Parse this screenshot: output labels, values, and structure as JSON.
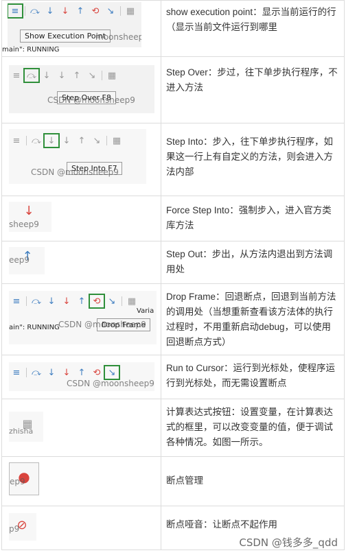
{
  "rows": [
    {
      "desc": "show execution point：显示当前运行的行（显示当前文件运行到哪里",
      "tooltip": "Show Execution Point",
      "watermark": "moonsheep9",
      "extra": "main\": RUNNING"
    },
    {
      "desc": "Step Over：步过，往下单步执行程序，不进入方法",
      "tooltip": "Step Over F8",
      "watermark": "CSDN @moonsheep9"
    },
    {
      "desc": "Step Into：步入，往下单步执行程序，如果这一行上有自定义的方法，则会进入方法内部",
      "tooltip": "Step Into F7",
      "watermark": "CSDN @moonsheep9"
    },
    {
      "desc": "Force Step Into：强制步入，进入官方类库方法",
      "watermark": "sheep9"
    },
    {
      "desc": "Step Out：步出，从方法内退出到方法调用处",
      "watermark": "eep9"
    },
    {
      "desc": "Drop Frame：回退断点，回退到当前方法的调用处（当想重新查看该方法体的执行过程时，不用重新启动debug，可以使用回退断点方式）",
      "tooltip": "Drop Frame",
      "watermark": "CSDN @moonsheep9",
      "extra": "ain\": RUNNING",
      "extra2": "Varia"
    },
    {
      "desc": "Run to Cursor：运行到光标处，使程序运行到光标处，而无需设置断点",
      "watermark": "CSDN @moonsheep9"
    },
    {
      "desc": "计算表达式按钮：设置变量，在计算表达式的框里，可以改变变量的值，便于调试各种情况。如图一所示。",
      "watermark": "zhisha"
    },
    {
      "desc": "断点管理",
      "watermark": "ep9"
    },
    {
      "desc": "断点哑音：让断点不起作用",
      "watermark": "p9"
    }
  ],
  "footer_watermark": "CSDN @钱多多_qdd",
  "icons": {
    "lines": "≡",
    "step_over": "⤼",
    "step_into": "↓",
    "force_step_into": "↓",
    "step_out": "↑",
    "drop_frame": "⟲",
    "run_to_cursor": "↘",
    "evaluate": "▦",
    "breakpoints": "●",
    "mute": "⊘"
  }
}
